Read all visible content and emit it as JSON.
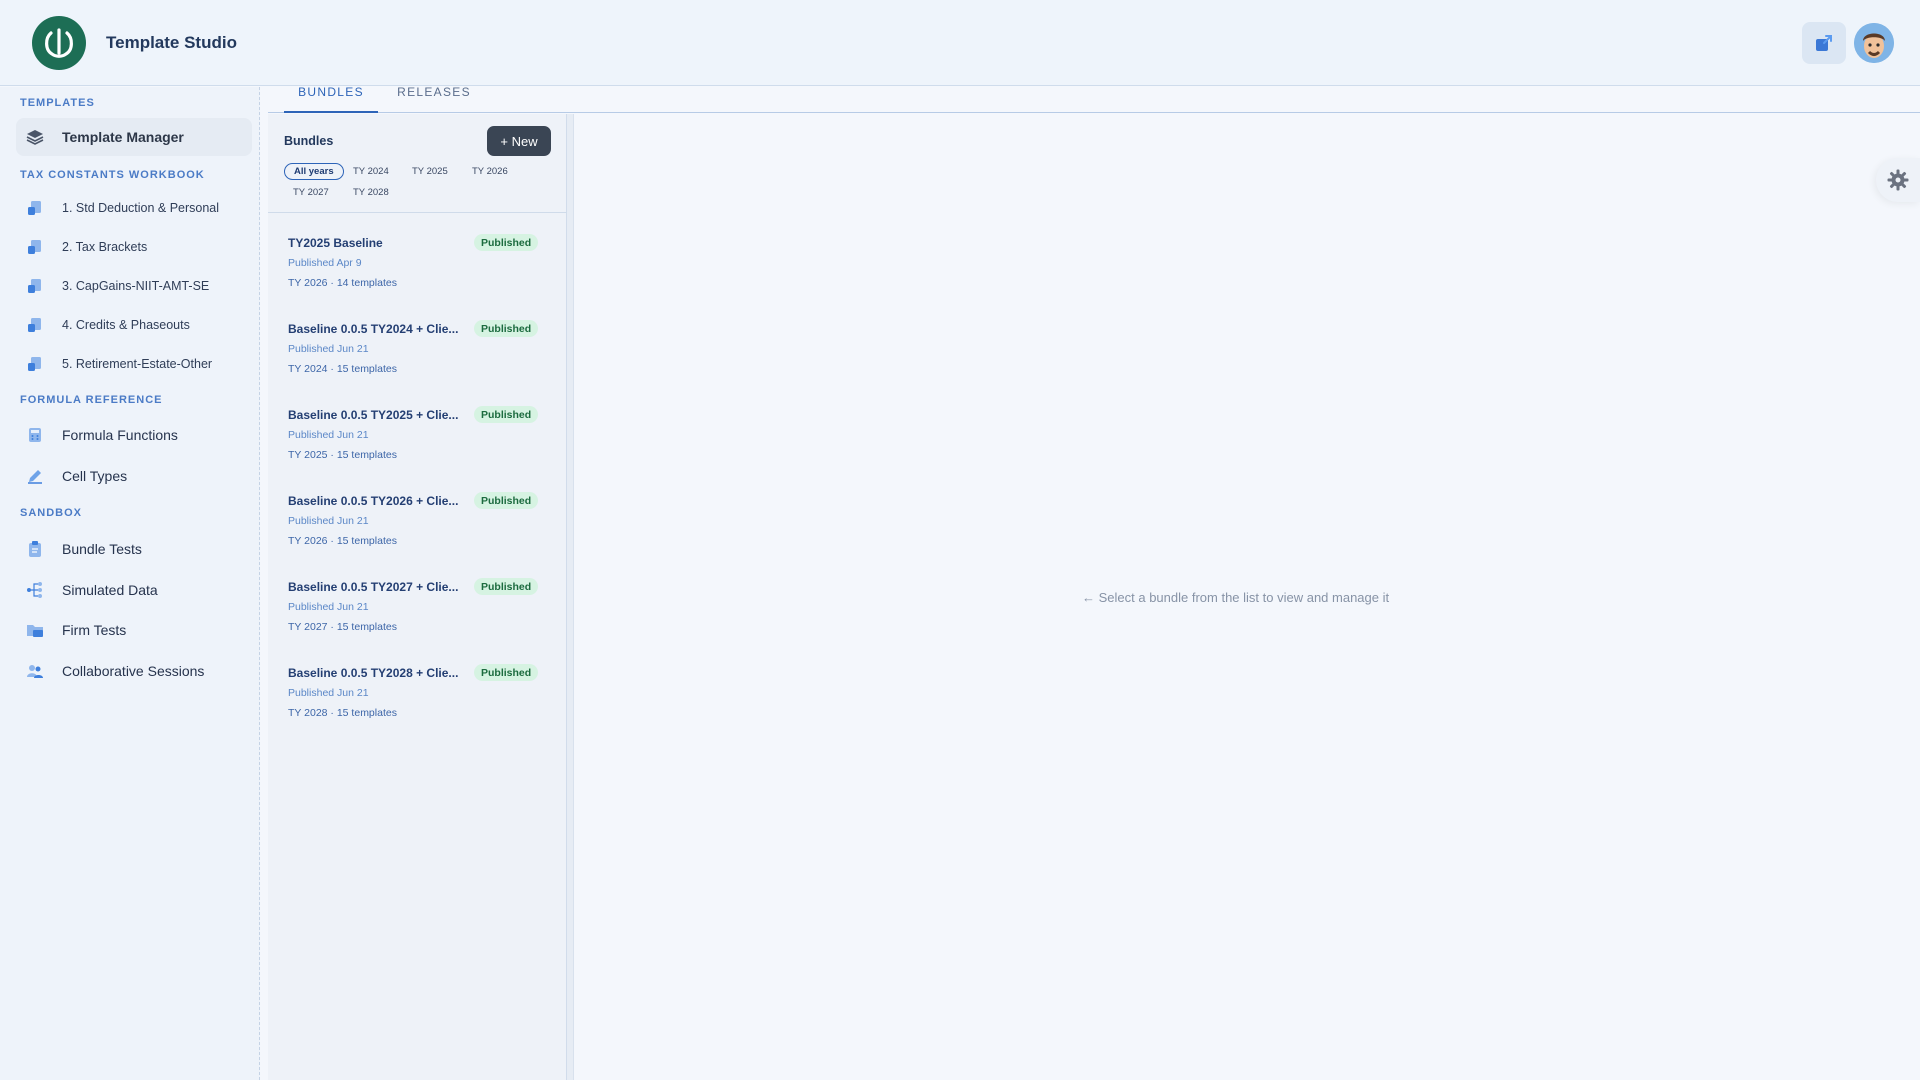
{
  "header": {
    "title": "Template Studio"
  },
  "sidebar": {
    "sections": [
      {
        "label": "TEMPLATES"
      },
      {
        "label": "TAX CONSTANTS WORKBOOK"
      },
      {
        "label": "FORMULA REFERENCE"
      },
      {
        "label": "SANDBOX"
      }
    ],
    "items": [
      {
        "label": "Template Manager",
        "icon": "layers-icon"
      },
      {
        "label": "1. Std Deduction & Personal",
        "icon": "sheet-link-icon"
      },
      {
        "label": "2. Tax Brackets",
        "icon": "sheet-link-icon"
      },
      {
        "label": "3. CapGains-NIIT-AMT-SE",
        "icon": "sheet-link-icon"
      },
      {
        "label": "4. Credits & Phaseouts",
        "icon": "sheet-link-icon"
      },
      {
        "label": "5. Retirement-Estate-Other",
        "icon": "sheet-link-icon"
      },
      {
        "label": "Formula Functions",
        "icon": "calculator-icon"
      },
      {
        "label": "Cell Types",
        "icon": "pencil-icon"
      },
      {
        "label": "Bundle Tests",
        "icon": "clipboard-icon"
      },
      {
        "label": "Simulated Data",
        "icon": "tree-icon"
      },
      {
        "label": "Firm Tests",
        "icon": "folder-icon"
      },
      {
        "label": "Collaborative Sessions",
        "icon": "users-icon"
      }
    ]
  },
  "tabs": [
    {
      "label": "BUNDLES",
      "active": true
    },
    {
      "label": "RELEASES",
      "active": false
    }
  ],
  "panel": {
    "title": "Bundles",
    "new_label": "+ New",
    "filters": [
      "All years",
      "TY 2024",
      "TY 2025",
      "TY 2026",
      "TY 2027",
      "TY 2028"
    ],
    "bundles": [
      {
        "title": "TY2025 Baseline",
        "status": "Published",
        "published": "Published Apr 9",
        "meta": "TY 2026 · 14 templates"
      },
      {
        "title": "Baseline 0.0.5 TY2024 + Clie...",
        "status": "Published",
        "published": "Published Jun 21",
        "meta": "TY 2024 · 15 templates"
      },
      {
        "title": "Baseline 0.0.5 TY2025 + Clie...",
        "status": "Published",
        "published": "Published Jun 21",
        "meta": "TY 2025 · 15 templates"
      },
      {
        "title": "Baseline 0.0.5 TY2026 + Clie...",
        "status": "Published",
        "published": "Published Jun 21",
        "meta": "TY 2026 · 15 templates"
      },
      {
        "title": "Baseline 0.0.5 TY2027 + Clie...",
        "status": "Published",
        "published": "Published Jun 21",
        "meta": "TY 2027 · 15 templates"
      },
      {
        "title": "Baseline 0.0.5 TY2028 + Clie...",
        "status": "Published",
        "published": "Published Jun 21",
        "meta": "TY 2028 · 15 templates"
      }
    ]
  },
  "main": {
    "empty_message": "← Select a bundle from the list to view and manage it"
  },
  "colors": {
    "accent": "#2d64b8",
    "brand": "#1d6e55",
    "published_bg": "#d6f3e2",
    "published_text": "#1c6b3f"
  }
}
